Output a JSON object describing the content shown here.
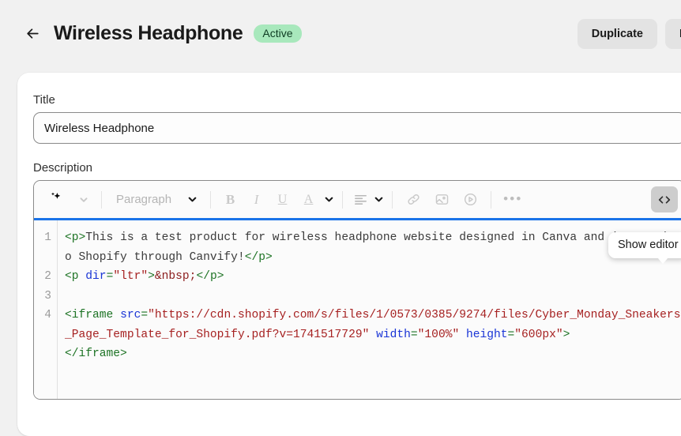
{
  "header": {
    "back_icon": "arrow-left-icon",
    "title": "Wireless Headphone",
    "status": "Active",
    "duplicate_label": "Duplicate",
    "clipped_label": "P"
  },
  "form": {
    "title_label": "Title",
    "title_value": "Wireless Headphone",
    "title_placeholder": "Title",
    "description_label": "Description"
  },
  "toolbar": {
    "magic_icon": "sparkle-icon",
    "magic_chevron_icon": "chevron-down-icon",
    "block_format": "Paragraph",
    "block_format_chevron_icon": "chevron-down-icon",
    "bold_label": "B",
    "italic_label": "I",
    "underline_label": "U",
    "text_color_label": "A",
    "text_color_chevron_icon": "chevron-down-icon",
    "align_icon": "align-left-icon",
    "align_chevron_icon": "chevron-down-icon",
    "link_icon": "link-icon",
    "image_icon": "image-icon",
    "video_icon": "video-play-icon",
    "more_label": "•••",
    "code_icon": "code-brackets-icon",
    "code_label": "</>"
  },
  "tooltip": {
    "text": "Show editor"
  },
  "editor": {
    "line_numbers": [
      "1",
      "2",
      "3",
      "4"
    ],
    "lines": [
      [
        {
          "t": "tag",
          "v": "<p>"
        },
        {
          "t": "text",
          "v": "This is a test product for wireless headphone website designed in Canva and imported to Shopify through Canvify!"
        },
        {
          "t": "tag",
          "v": "</p>"
        }
      ],
      [
        {
          "t": "tag",
          "v": "<p "
        },
        {
          "t": "attr",
          "v": "dir"
        },
        {
          "t": "tag",
          "v": "="
        },
        {
          "t": "val",
          "v": "\"ltr\""
        },
        {
          "t": "tag",
          "v": ">"
        },
        {
          "t": "ent",
          "v": "&nbsp;"
        },
        {
          "t": "tag",
          "v": "</p>"
        }
      ],
      [],
      [
        {
          "t": "tag",
          "v": "<iframe "
        },
        {
          "t": "attr",
          "v": "src"
        },
        {
          "t": "tag",
          "v": "="
        },
        {
          "t": "val",
          "v": "\"https://cdn.shopify.com/s/files/1/0573/0385/9274/files/Cyber_Monday_Sneakers_Page_Template_for_Shopify.pdf?v=1741517729\""
        },
        {
          "t": "tag",
          "v": " "
        },
        {
          "t": "attr",
          "v": "width"
        },
        {
          "t": "tag",
          "v": "="
        },
        {
          "t": "val",
          "v": "\"100%\""
        },
        {
          "t": "tag",
          "v": " "
        },
        {
          "t": "attr",
          "v": "height"
        },
        {
          "t": "tag",
          "v": "="
        },
        {
          "t": "val",
          "v": "\"600px\""
        },
        {
          "t": "tag",
          "v": ">"
        },
        {
          "t": "br",
          "v": ""
        },
        {
          "t": "tag",
          "v": "</iframe>"
        }
      ]
    ]
  },
  "colors": {
    "page_bg": "#f1f1f1",
    "accent_blue": "#1a73e8",
    "badge_bg": "#a8e8bc",
    "badge_text": "#0e3b22",
    "tag": "#1d7324",
    "attr": "#1a35d6",
    "value": "#a62121"
  }
}
